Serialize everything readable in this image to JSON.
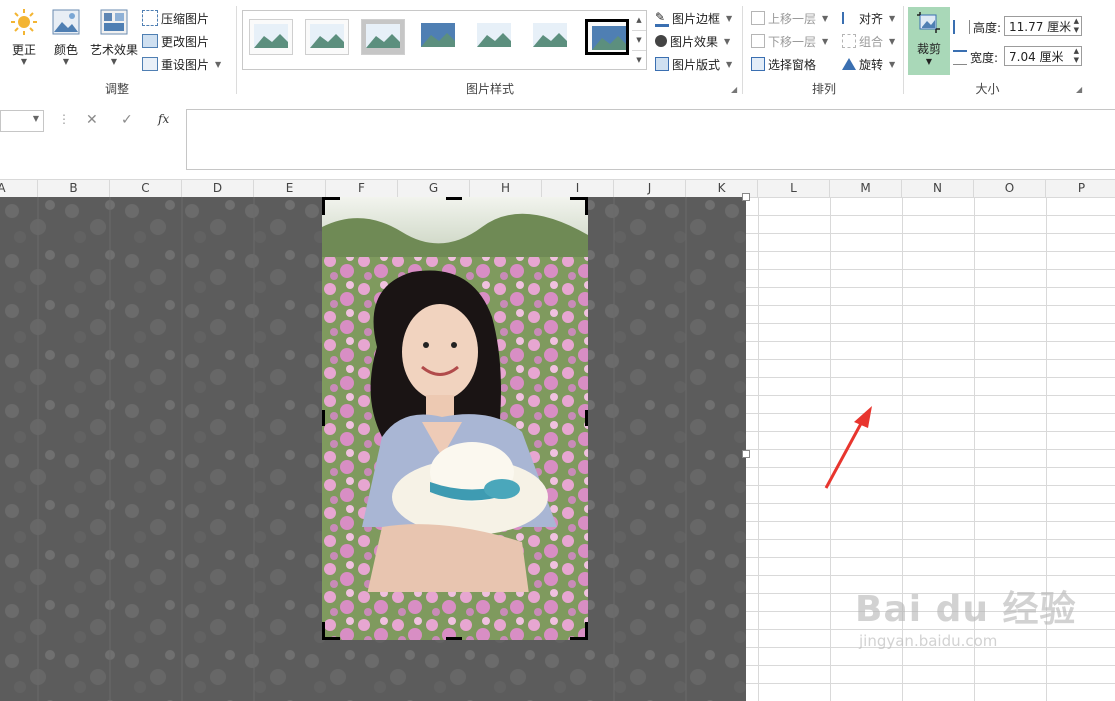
{
  "ribbon": {
    "adjust": {
      "group_label": "调整",
      "corrections": "更正",
      "color": "颜色",
      "artistic": "艺术效果",
      "compress": "压缩图片",
      "change": "更改图片",
      "reset": "重设图片"
    },
    "styles": {
      "group_label": "图片样式",
      "border": "图片边框",
      "effects": "图片效果",
      "layout": "图片版式"
    },
    "arrange": {
      "group_label": "排列",
      "bring_forward": "上移一层",
      "send_backward": "下移一层",
      "selection_pane": "选择窗格",
      "align": "对齐",
      "group": "组合",
      "rotate": "旋转"
    },
    "size": {
      "group_label": "大小",
      "crop": "裁剪",
      "height_label": "高度:",
      "height_value": "11.77 厘米",
      "width_label": "宽度:",
      "width_value": "7.04 厘米"
    }
  },
  "formula": {
    "fx": "fx"
  },
  "columns": [
    "A",
    "B",
    "C",
    "D",
    "E",
    "F",
    "G",
    "H",
    "I",
    "J",
    "K",
    "L",
    "M",
    "N",
    "O",
    "P"
  ],
  "watermark": {
    "brand": "Bai du 经验",
    "url": "jingyan.baidu.com"
  },
  "colors": {
    "crop_active": "#a9d8b8",
    "arrow": "#e8352e"
  }
}
